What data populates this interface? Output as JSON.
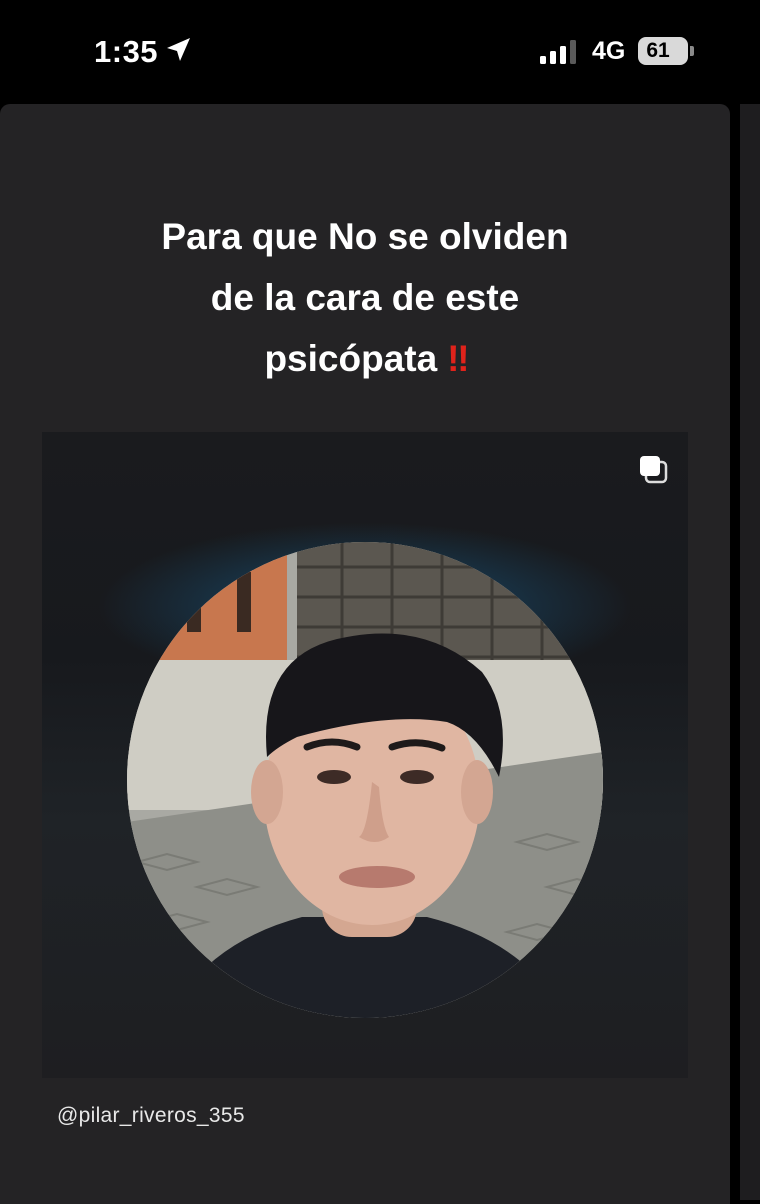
{
  "status_bar": {
    "time": "1:35",
    "network": "4G",
    "battery": "61",
    "icons": [
      "location-arrow-icon",
      "signal-bars-icon",
      "battery-icon"
    ]
  },
  "story": {
    "headline_lines": [
      "Para que No se olviden",
      "de la cara de este",
      "psicópata"
    ],
    "headline_emoji": "‼",
    "shared_post": {
      "icon": "multiple-posts-icon",
      "image": "profile-photo"
    },
    "handle": "@pilar_riveros_355"
  },
  "colors": {
    "background": "#000000",
    "card": "#242325",
    "emoji_red": "#e0231b",
    "post_glow": "#18567e"
  }
}
